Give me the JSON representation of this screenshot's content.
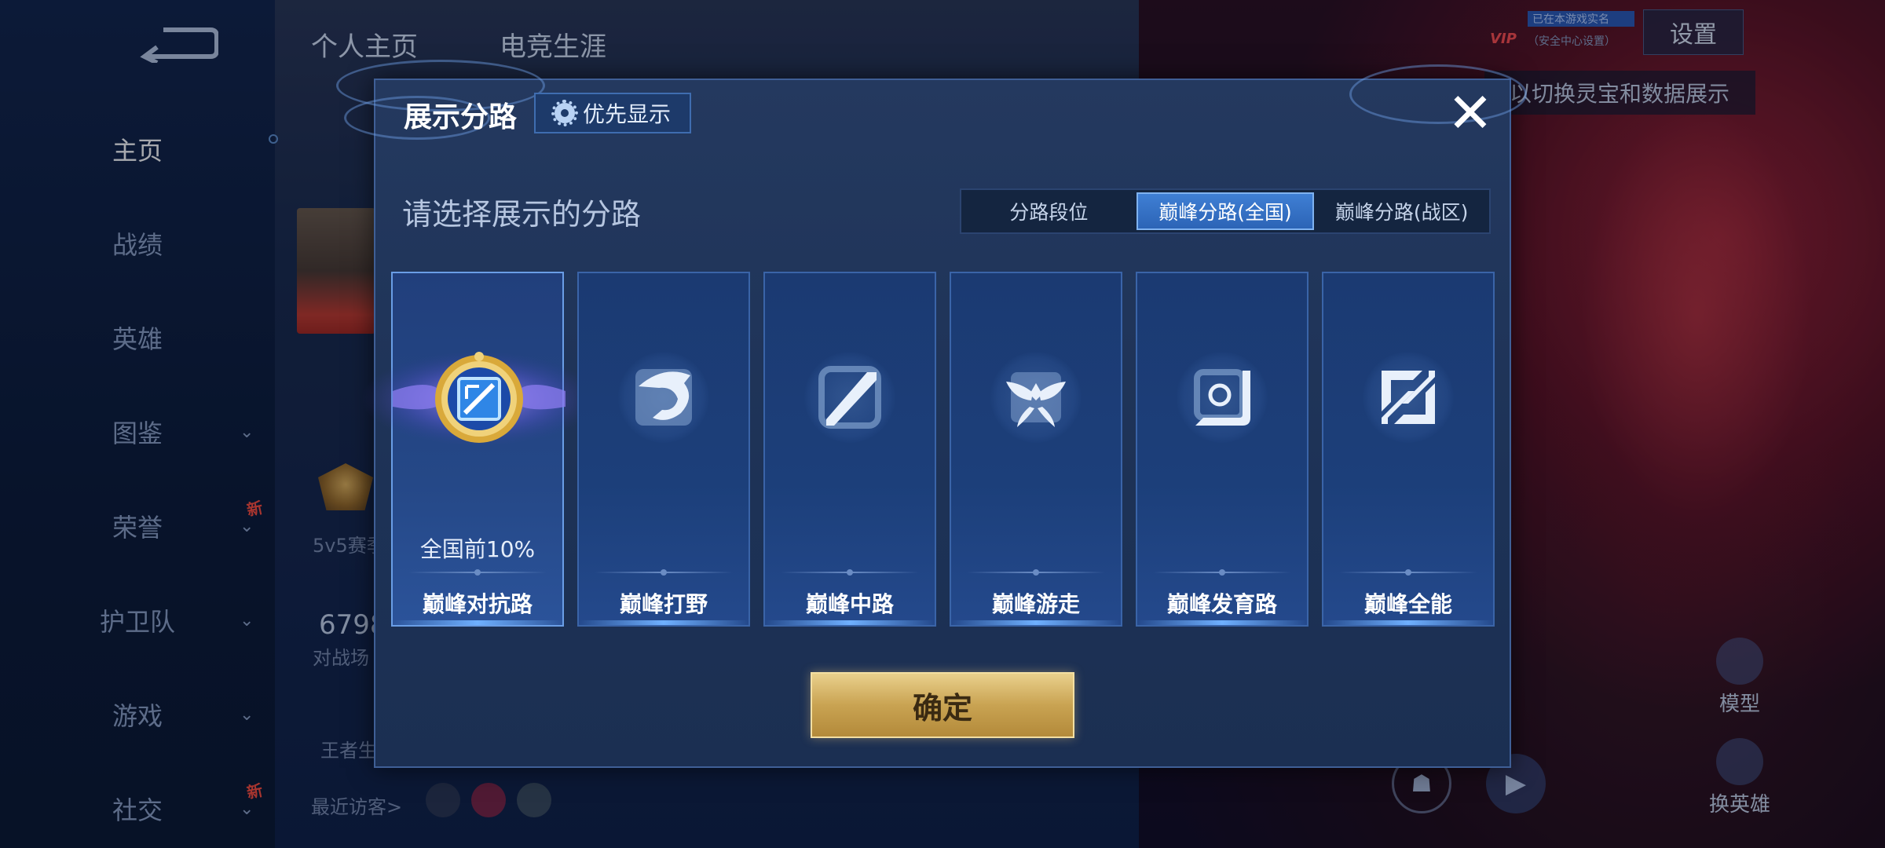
{
  "background": {
    "tabs": [
      "个人主页",
      "电竞生涯"
    ],
    "nav": [
      {
        "label": "主页",
        "active": true,
        "has_chevron": false,
        "is_new": false
      },
      {
        "label": "战绩",
        "active": false,
        "has_chevron": false,
        "is_new": false
      },
      {
        "label": "英雄",
        "active": false,
        "has_chevron": false,
        "is_new": false
      },
      {
        "label": "图鉴",
        "active": false,
        "has_chevron": true,
        "is_new": false
      },
      {
        "label": "荣誉",
        "active": false,
        "has_chevron": true,
        "is_new": true
      },
      {
        "label": "护卫队",
        "active": false,
        "has_chevron": true,
        "is_new": false
      },
      {
        "label": "游戏",
        "active": false,
        "has_chevron": true,
        "is_new": false
      },
      {
        "label": "社交",
        "active": false,
        "has_chevron": true,
        "is_new": true
      }
    ],
    "new_badge": "新",
    "stats_label": "5v5赛季",
    "battle_count": "6798",
    "battle_label": "对战场",
    "partial_label": "王者生",
    "recent_visitors": "最近访客>",
    "settings": "设置",
    "vip": "VIP",
    "vip_info": "已在本游戏实名",
    "vip_info2": "（安全中心设置）",
    "hint": "以切换灵宝和数据展示",
    "model_label": "模型",
    "change_hero_label": "换英雄"
  },
  "modal": {
    "title": "展示分路",
    "priority_button": "优先显示",
    "subtitle": "请选择展示的分路",
    "segments": [
      {
        "label": "分路段位",
        "active": false
      },
      {
        "label": "巅峰分路(全国)",
        "active": true
      },
      {
        "label": "巅峰分路(战区)",
        "active": false
      }
    ],
    "lanes": [
      {
        "name": "巅峰对抗路",
        "rank": "全国前10%",
        "selected": true,
        "icon": "clash-lane-icon"
      },
      {
        "name": "巅峰打野",
        "rank": "",
        "selected": false,
        "icon": "jungle-dragon-icon"
      },
      {
        "name": "巅峰中路",
        "rank": "",
        "selected": false,
        "icon": "mid-lane-icon"
      },
      {
        "name": "巅峰游走",
        "rank": "",
        "selected": false,
        "icon": "roam-wings-icon"
      },
      {
        "name": "巅峰发育路",
        "rank": "",
        "selected": false,
        "icon": "farm-lane-icon"
      },
      {
        "name": "巅峰全能",
        "rank": "",
        "selected": false,
        "icon": "all-round-icon"
      }
    ],
    "confirm": "确定",
    "close": "✕"
  },
  "colors": {
    "accent": "#2c64b6",
    "gold": "#c9a352",
    "modal_bg": "#1d3256"
  }
}
